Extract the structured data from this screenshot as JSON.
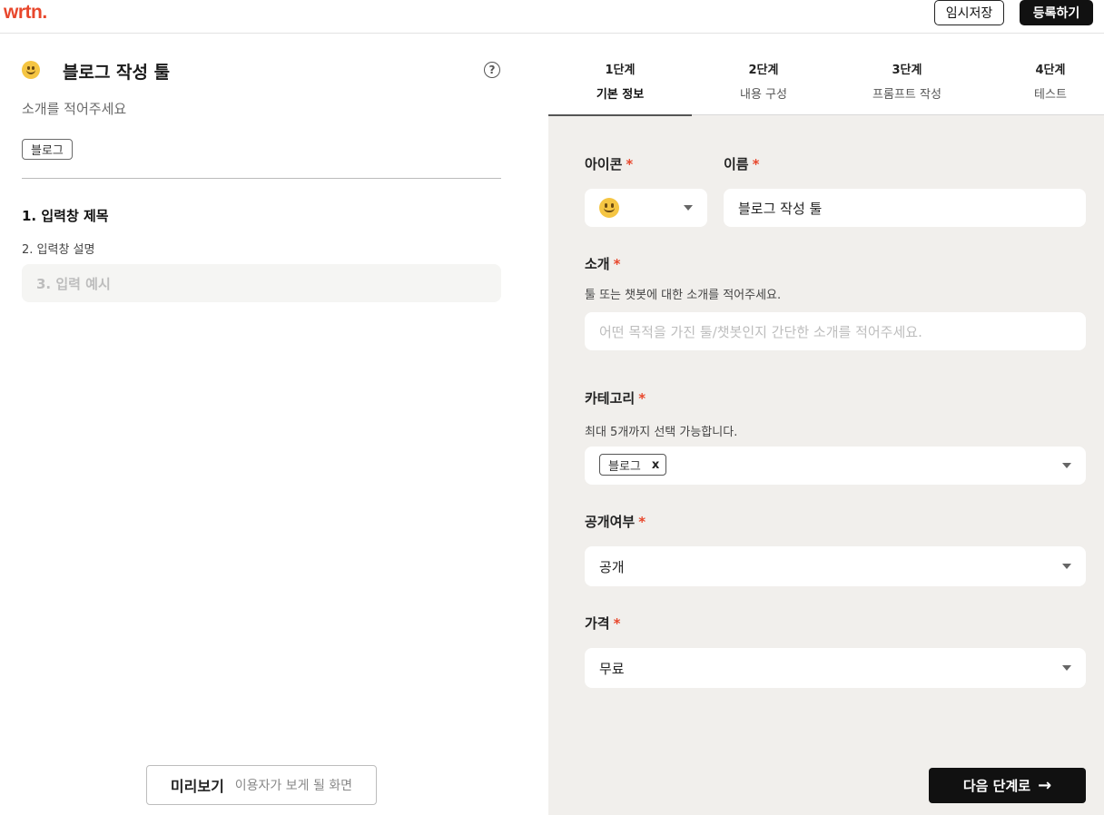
{
  "header": {
    "logo": "wrtn.",
    "save_label": "임시저장",
    "register_label": "등록하기"
  },
  "left": {
    "tool_title": "블로그 작성 툴",
    "help_symbol": "?",
    "intro_hint": "소개를 적어주세요",
    "tag": "블로그",
    "fields": [
      "1. 입력창 제목",
      "2. 입력창 설명",
      "3. 입력 예시"
    ],
    "preview": {
      "label": "미리보기",
      "sub": "이용자가 보게 될 화면"
    }
  },
  "steps": [
    {
      "num": "1단계",
      "name": "기본 정보"
    },
    {
      "num": "2단계",
      "name": "내용 구성"
    },
    {
      "num": "3단계",
      "name": "프롬프트 작성"
    },
    {
      "num": "4단계",
      "name": "테스트"
    }
  ],
  "form": {
    "required_mark": "*",
    "icon_label": "아이콘",
    "icon_value": "smiley-emoji",
    "name_label": "이름",
    "name_value": "블로그 작성 툴",
    "intro_label": "소개",
    "intro_help": "툴 또는 챗봇에 대한 소개를 적어주세요.",
    "intro_placeholder": "어떤 목적을 가진 툴/챗봇인지 간단한 소개를 적어주세요.",
    "category_label": "카테고리",
    "category_help": "최대 5개까지 선택 가능합니다.",
    "category_selected": "블로그",
    "category_remove": "x",
    "visibility_label": "공개여부",
    "visibility_value": "공개",
    "price_label": "가격",
    "price_value": "무료"
  },
  "next_button": {
    "label": "다음 단계로",
    "arrow": "→"
  },
  "colors": {
    "accent": "#e8472c",
    "dark": "#111111",
    "panel_bg": "#f1efec"
  }
}
